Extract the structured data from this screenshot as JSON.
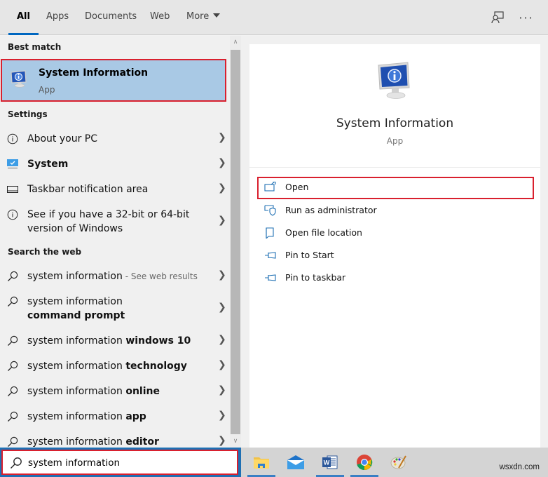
{
  "tabs": [
    {
      "label": "All",
      "active": true
    },
    {
      "label": "Apps",
      "active": false
    },
    {
      "label": "Documents",
      "active": false
    },
    {
      "label": "Web",
      "active": false
    },
    {
      "label": "More",
      "active": false
    }
  ],
  "topbar_icons": {
    "feedback": "feedback-icon",
    "more": "more-options-icon",
    "more_glyph": "···"
  },
  "best_match": {
    "header": "Best match",
    "title": "System Information",
    "subtitle": "App",
    "icon": "system-information-icon",
    "highlight_color": "#d9202e"
  },
  "settings": {
    "header": "Settings",
    "items": [
      {
        "label": "About your PC",
        "icon": "info-icon",
        "bold": false
      },
      {
        "label": "System",
        "icon": "system-monitor-icon",
        "bold": true
      },
      {
        "label": "Taskbar notification area",
        "icon": "taskbar-icon",
        "bold": false
      },
      {
        "label": "See if you have a 32-bit or 64-bit version of Windows",
        "icon": "info-icon",
        "bold": false
      }
    ]
  },
  "web": {
    "header": "Search the web",
    "items": [
      {
        "prefix": "system information",
        "bold": "",
        "suffix": " - See web results"
      },
      {
        "prefix": "system information ",
        "bold": "command prompt",
        "suffix": ""
      },
      {
        "prefix": "system information ",
        "bold": "windows 10",
        "suffix": ""
      },
      {
        "prefix": "system information ",
        "bold": "technology",
        "suffix": ""
      },
      {
        "prefix": "system information ",
        "bold": "online",
        "suffix": ""
      },
      {
        "prefix": "system information ",
        "bold": "app",
        "suffix": ""
      },
      {
        "prefix": "system information ",
        "bold": "editor",
        "suffix": ""
      }
    ]
  },
  "detail": {
    "title": "System Information",
    "subtitle": "App",
    "actions": [
      {
        "label": "Open",
        "icon": "open-icon",
        "highlighted": true
      },
      {
        "label": "Run as administrator",
        "icon": "run-as-admin-icon",
        "highlighted": false
      },
      {
        "label": "Open file location",
        "icon": "file-location-icon",
        "highlighted": false
      },
      {
        "label": "Pin to Start",
        "icon": "pin-icon",
        "highlighted": false
      },
      {
        "label": "Pin to taskbar",
        "icon": "pin-icon",
        "highlighted": false
      }
    ]
  },
  "search": {
    "value": "system information",
    "placeholder": ""
  },
  "taskbar": {
    "apps": [
      {
        "name": "File Explorer",
        "icon": "file-explorer-icon",
        "running": true
      },
      {
        "name": "Mail",
        "icon": "mail-icon",
        "running": false
      },
      {
        "name": "Word",
        "icon": "word-icon",
        "running": true
      },
      {
        "name": "Chrome",
        "icon": "chrome-icon",
        "running": true
      },
      {
        "name": "Paint",
        "icon": "paint-icon",
        "running": false
      }
    ],
    "watermark": "wsxdn.com"
  },
  "colors": {
    "accent": "#0067c0",
    "selection": "#a9c9e5",
    "highlight_border": "#d9202e",
    "icon_blue": "#1e6fb3"
  }
}
